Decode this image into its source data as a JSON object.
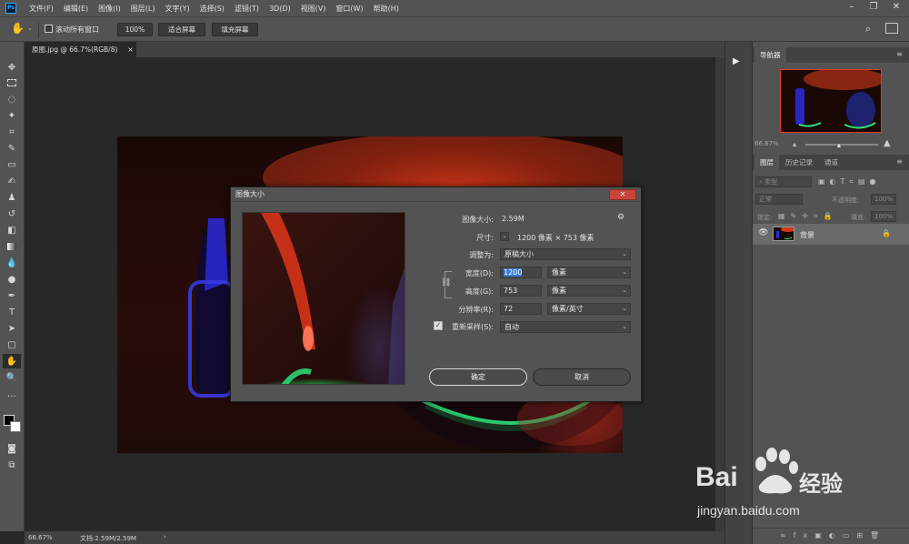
{
  "menu": {
    "logo": "Ps",
    "items": [
      "文件(F)",
      "编辑(E)",
      "图像(I)",
      "图层(L)",
      "文字(Y)",
      "选择(S)",
      "滤镜(T)",
      "3D(D)",
      "视图(V)",
      "窗口(W)",
      "帮助(H)"
    ]
  },
  "options": {
    "scroll_all_label": "滚动所有窗口",
    "zoom_button": "100%",
    "fit_screen_button": "适合屏幕",
    "fill_screen_button": "填充屏幕"
  },
  "document": {
    "tab_title": "原图.jpg @ 66.7%(RGB/8)",
    "tab_close": "×"
  },
  "status": {
    "zoom": "66.67%",
    "doc_info": "文档:2.59M/2.59M",
    "arrow": "›"
  },
  "navigator": {
    "tab": "导航器",
    "zoom": "66.67%"
  },
  "layers_panel": {
    "tabs": [
      "图层",
      "历史记录",
      "通道"
    ],
    "filter_placeholder": "类型",
    "blend_mode": "正常",
    "opacity_label": "不透明度:",
    "opacity_value": "100%",
    "lock_label": "锁定:",
    "fill_label": "填充:",
    "fill_value": "100%",
    "layer_name": "背景"
  },
  "dialog": {
    "title": "图像大小",
    "close": "✕",
    "image_size_label": "图像大小:",
    "image_size_value": "2.59M",
    "dimensions_label": "尺寸:",
    "dimensions_value": "1200 像素 × 753 像素",
    "fit_to_label": "调整为:",
    "fit_to_value": "原稿大小",
    "width_label": "宽度(D):",
    "width_value": "1200",
    "width_unit": "像素",
    "height_label": "高度(G):",
    "height_value": "753",
    "height_unit": "像素",
    "resolution_label": "分辨率(R):",
    "resolution_value": "72",
    "resolution_unit": "像素/英寸",
    "resample_label": "重新采样(S):",
    "resample_value": "自动",
    "resample_checked": true,
    "ok_button": "确定",
    "cancel_button": "取消"
  },
  "watermark": {
    "brand_left": "Bai",
    "brand_right": "经验",
    "url": "jingyan.baidu.com"
  },
  "colors": {
    "accent": "#31a8ff",
    "close_red": "#c8453a",
    "ui_dark": "#535353"
  }
}
